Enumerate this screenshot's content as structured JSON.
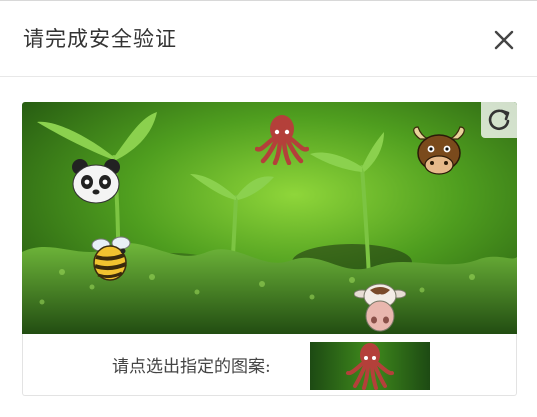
{
  "dialog": {
    "title": "请完成安全验证"
  },
  "captcha": {
    "targets": [
      {
        "name": "panda",
        "icon": "panda-icon"
      },
      {
        "name": "bee",
        "icon": "bee-icon"
      },
      {
        "name": "octopus",
        "icon": "octopus-icon"
      },
      {
        "name": "bull",
        "icon": "bull-head-icon"
      },
      {
        "name": "cow",
        "icon": "cow-head-icon"
      }
    ],
    "instruction": "请点选出指定的图案:",
    "target_icon": "octopus-icon",
    "refresh_icon": "refresh-icon"
  },
  "colors": {
    "background_green": "#3f8a1c",
    "moss_green": "#2f6e1a",
    "octopus_red": "#b4403a",
    "text": "#444444"
  }
}
